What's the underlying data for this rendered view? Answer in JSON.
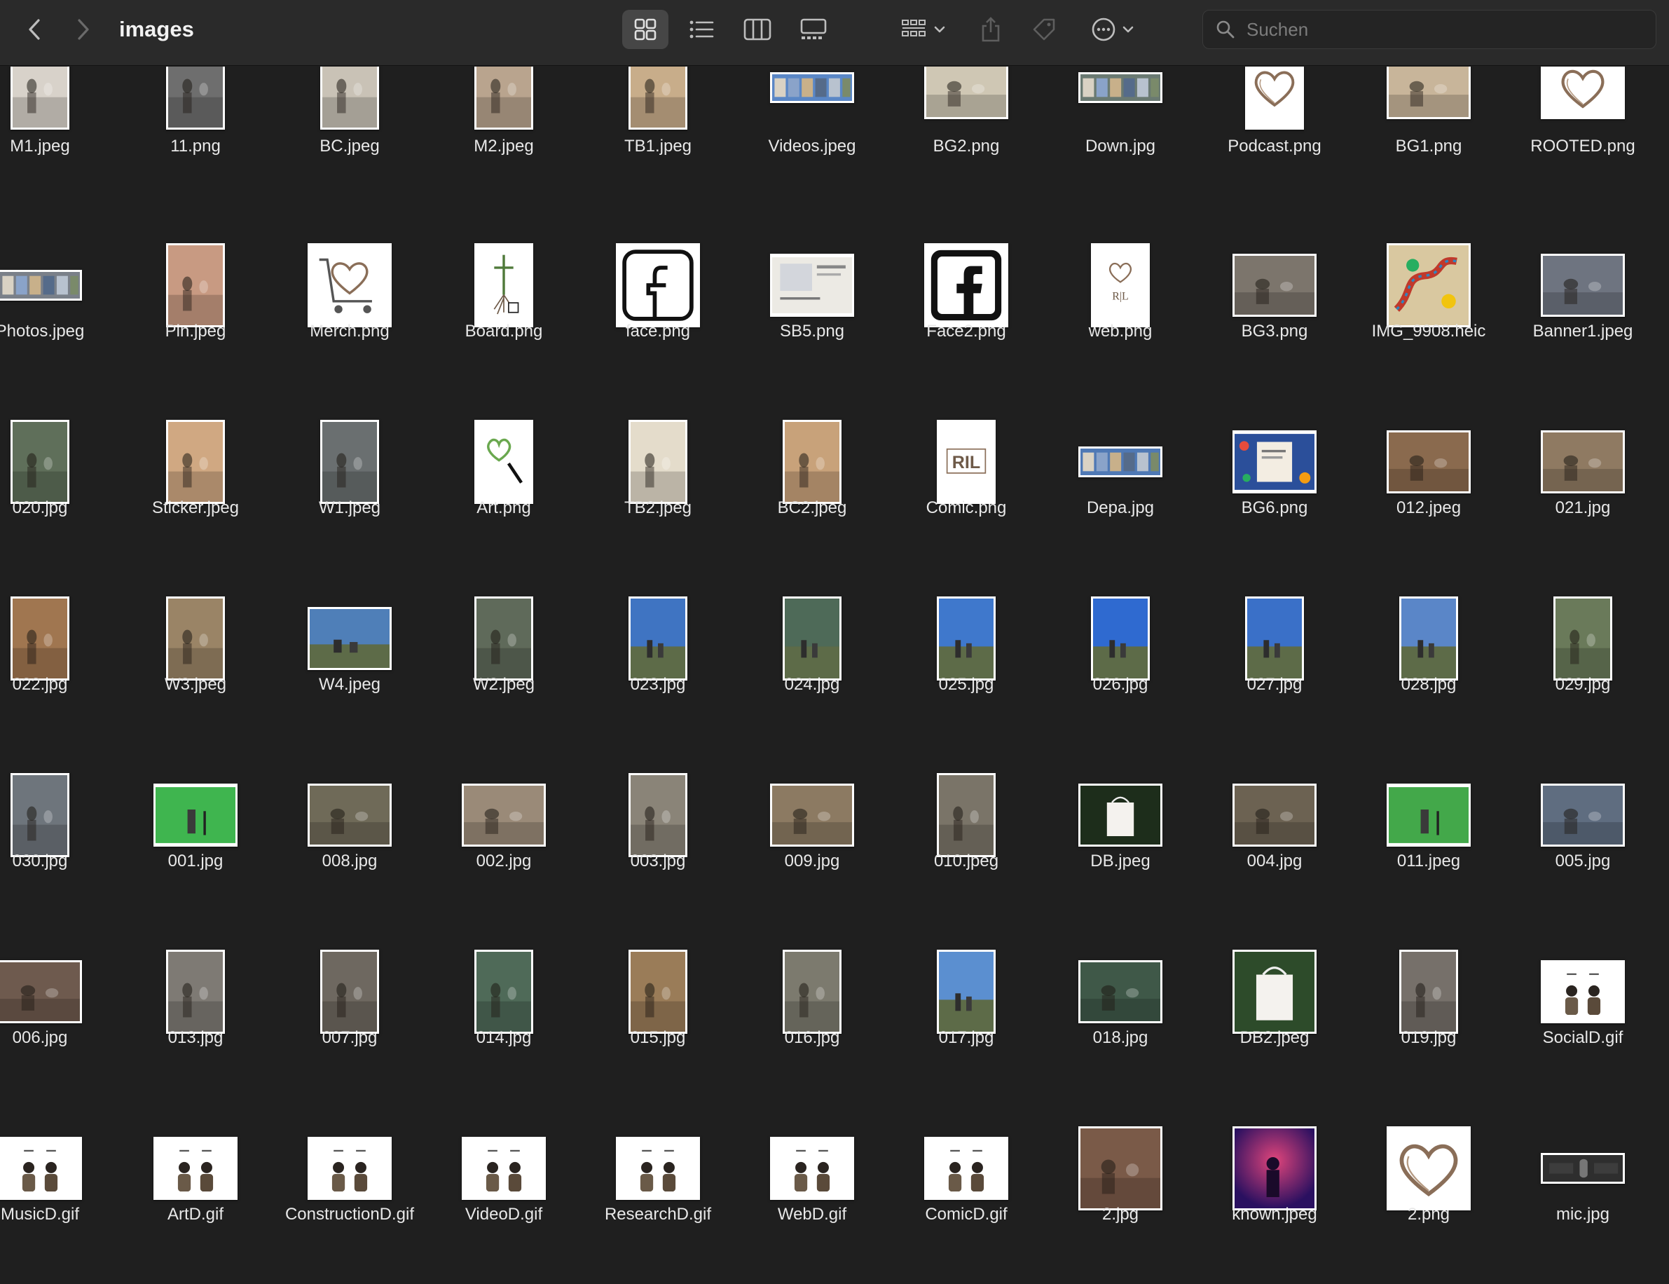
{
  "window": {
    "title": "images"
  },
  "toolbar": {
    "back": "chevron-left-icon",
    "forward": "chevron-right-icon",
    "views": [
      "icon-view-icon",
      "list-view-icon",
      "column-view-icon",
      "gallery-view-icon"
    ],
    "active_view": 0,
    "group": "group-icon",
    "share": "share-icon",
    "tag": "tag-icon",
    "more": "more-icon"
  },
  "search": {
    "placeholder": "Suchen",
    "value": ""
  },
  "files": [
    {
      "name": "M1.jpeg",
      "shape": "p",
      "kind": "photo",
      "color": "#d8d2ca"
    },
    {
      "name": "11.png",
      "shape": "p",
      "kind": "photo",
      "color": "#6e6e6e"
    },
    {
      "name": "BC.jpeg",
      "shape": "p",
      "kind": "photo",
      "color": "#c9c2b6"
    },
    {
      "name": "M2.jpeg",
      "shape": "p",
      "kind": "photo",
      "color": "#b9a48e"
    },
    {
      "name": "TB1.jpeg",
      "shape": "p",
      "kind": "photo",
      "color": "#c8ad8a"
    },
    {
      "name": "Videos.jpeg",
      "shape": "w",
      "kind": "strip",
      "color": "#5a87c6"
    },
    {
      "name": "BG2.png",
      "shape": "l",
      "kind": "photo",
      "color": "#cfc7b4"
    },
    {
      "name": "Down.jpg",
      "shape": "w",
      "kind": "strip",
      "color": "#6a7a72"
    },
    {
      "name": "Podcast.png",
      "shape": "p",
      "kind": "heart",
      "color": "#ffffff"
    },
    {
      "name": "BG1.png",
      "shape": "l",
      "kind": "photo",
      "color": "#c8b59a"
    },
    {
      "name": "ROOTED.png",
      "shape": "l",
      "kind": "heart",
      "color": "#ffffff"
    },
    {
      "name": "Photos.jpeg",
      "shape": "w",
      "kind": "strip",
      "color": "#7a8089"
    },
    {
      "name": "Pin.jpeg",
      "shape": "p",
      "kind": "photo",
      "color": "#c89a82"
    },
    {
      "name": "Merch.png",
      "shape": "s",
      "kind": "cart",
      "color": "#ffffff"
    },
    {
      "name": "Board.png",
      "shape": "p",
      "kind": "tree",
      "color": "#ffffff"
    },
    {
      "name": "face.png",
      "shape": "s",
      "kind": "fb",
      "color": "#ffffff"
    },
    {
      "name": "SB5.png",
      "shape": "l",
      "kind": "doc",
      "color": "#e8e6e0"
    },
    {
      "name": "Face2.png",
      "shape": "s",
      "kind": "fb2",
      "color": "#ffffff"
    },
    {
      "name": "web.png",
      "shape": "p",
      "kind": "ril",
      "color": "#ffffff"
    },
    {
      "name": "BG3.png",
      "shape": "l",
      "kind": "photo",
      "color": "#7c756c"
    },
    {
      "name": "IMG_9908.heic",
      "shape": "s",
      "kind": "board",
      "color": "#d9c8a0"
    },
    {
      "name": "Banner1.jpeg",
      "shape": "l",
      "kind": "photo",
      "color": "#6e7480"
    },
    {
      "name": "020.jpg",
      "shape": "p",
      "kind": "photo",
      "color": "#5f6f5a"
    },
    {
      "name": "Sticker.jpeg",
      "shape": "p",
      "kind": "photo",
      "color": "#d0a882"
    },
    {
      "name": "W1.jpeg",
      "shape": "p",
      "kind": "photo",
      "color": "#6a6f70"
    },
    {
      "name": "Art.png",
      "shape": "p",
      "kind": "art",
      "color": "#ffffff"
    },
    {
      "name": "TB2.jpeg",
      "shape": "p",
      "kind": "photo",
      "color": "#e4dccb"
    },
    {
      "name": "BC2.jpeg",
      "shape": "p",
      "kind": "photo",
      "color": "#c8a27a"
    },
    {
      "name": "Comic.png",
      "shape": "p",
      "kind": "comic",
      "color": "#ffffff"
    },
    {
      "name": "Depa.jpg",
      "shape": "w",
      "kind": "strip",
      "color": "#4f79b5"
    },
    {
      "name": "BG6.png",
      "shape": "l",
      "kind": "colorful",
      "color": "#2b4f9a"
    },
    {
      "name": "012.jpeg",
      "shape": "l",
      "kind": "photo",
      "color": "#8a6a4e"
    },
    {
      "name": "021.jpg",
      "shape": "l",
      "kind": "photo",
      "color": "#8f7a62"
    },
    {
      "name": "022.jpg",
      "shape": "p",
      "kind": "photo",
      "color": "#a07650"
    },
    {
      "name": "W3.jpeg",
      "shape": "p",
      "kind": "photo",
      "color": "#9a8466"
    },
    {
      "name": "W4.jpeg",
      "shape": "l",
      "kind": "sky",
      "color": "#4f7fb8"
    },
    {
      "name": "W2.jpeg",
      "shape": "p",
      "kind": "photo",
      "color": "#5f6a5a"
    },
    {
      "name": "023.jpg",
      "shape": "p",
      "kind": "sky",
      "color": "#3f74c2"
    },
    {
      "name": "024.jpg",
      "shape": "p",
      "kind": "sky",
      "color": "#4e6a58"
    },
    {
      "name": "025.jpg",
      "shape": "p",
      "kind": "sky",
      "color": "#3f78cc"
    },
    {
      "name": "026.jpg",
      "shape": "p",
      "kind": "sky",
      "color": "#2f6ad0"
    },
    {
      "name": "027.jpg",
      "shape": "p",
      "kind": "sky",
      "color": "#3a70c8"
    },
    {
      "name": "028.jpg",
      "shape": "p",
      "kind": "sky",
      "color": "#5a86c8"
    },
    {
      "name": "029.jpg",
      "shape": "p",
      "kind": "photo",
      "color": "#6a7a5a"
    },
    {
      "name": "030.jpg",
      "shape": "p",
      "kind": "photo",
      "color": "#6e757c"
    },
    {
      "name": "001.jpg",
      "shape": "l",
      "kind": "green",
      "color": "#3fb54f"
    },
    {
      "name": "008.jpg",
      "shape": "l",
      "kind": "photo",
      "color": "#6f6a58"
    },
    {
      "name": "002.jpg",
      "shape": "l",
      "kind": "photo",
      "color": "#9a8a78"
    },
    {
      "name": "003.jpg",
      "shape": "p",
      "kind": "photo",
      "color": "#8a8478"
    },
    {
      "name": "009.jpg",
      "shape": "l",
      "kind": "photo",
      "color": "#8c7a62"
    },
    {
      "name": "010.jpeg",
      "shape": "p",
      "kind": "photo",
      "color": "#7a7468"
    },
    {
      "name": "DB.jpeg",
      "shape": "l",
      "kind": "bag",
      "color": "#1d2d1b"
    },
    {
      "name": "004.jpg",
      "shape": "l",
      "kind": "photo",
      "color": "#6c6252"
    },
    {
      "name": "011.jpeg",
      "shape": "l",
      "kind": "green",
      "color": "#43a84a"
    },
    {
      "name": "005.jpg",
      "shape": "l",
      "kind": "photo",
      "color": "#5f6d80"
    },
    {
      "name": "006.jpg",
      "shape": "l",
      "kind": "photo",
      "color": "#6e5a4e"
    },
    {
      "name": "013.jpg",
      "shape": "p",
      "kind": "photo",
      "color": "#7e7a74"
    },
    {
      "name": "007.jpg",
      "shape": "p",
      "kind": "photo",
      "color": "#6e6860"
    },
    {
      "name": "014.jpg",
      "shape": "p",
      "kind": "photo",
      "color": "#4f6a58"
    },
    {
      "name": "015.jpg",
      "shape": "p",
      "kind": "photo",
      "color": "#9a7c58"
    },
    {
      "name": "016.jpg",
      "shape": "p",
      "kind": "photo",
      "color": "#7c7a6e"
    },
    {
      "name": "017.jpg",
      "shape": "p",
      "kind": "sky",
      "color": "#5b8fd0"
    },
    {
      "name": "018.jpg",
      "shape": "l",
      "kind": "photo",
      "color": "#3f5848"
    },
    {
      "name": "DB2.jpeg",
      "shape": "s",
      "kind": "bag",
      "color": "#2d4b2a"
    },
    {
      "name": "019.jpg",
      "shape": "p",
      "kind": "photo",
      "color": "#76706a"
    },
    {
      "name": "SocialD.gif",
      "shape": "l",
      "kind": "people",
      "color": "#ffffff"
    },
    {
      "name": "MusicD.gif",
      "shape": "l",
      "kind": "people",
      "color": "#ffffff"
    },
    {
      "name": "ArtD.gif",
      "shape": "l",
      "kind": "people",
      "color": "#ffffff"
    },
    {
      "name": "ConstructionD.gif",
      "shape": "l",
      "kind": "people",
      "color": "#ffffff"
    },
    {
      "name": "VideoD.gif",
      "shape": "l",
      "kind": "people",
      "color": "#ffffff"
    },
    {
      "name": "ResearchD.gif",
      "shape": "l",
      "kind": "people",
      "color": "#ffffff"
    },
    {
      "name": "WebD.gif",
      "shape": "l",
      "kind": "people",
      "color": "#ffffff"
    },
    {
      "name": "ComicD.gif",
      "shape": "l",
      "kind": "people",
      "color": "#ffffff"
    },
    {
      "name": "2.jpg",
      "shape": "s",
      "kind": "photo",
      "color": "#7a5a48"
    },
    {
      "name": "known.jpeg",
      "shape": "s",
      "kind": "concert",
      "color": "#5a1f8a"
    },
    {
      "name": "2.png",
      "shape": "s",
      "kind": "heart",
      "color": "#ffffff"
    },
    {
      "name": "mic.jpg",
      "shape": "w",
      "kind": "mic",
      "color": "#3a3a3a"
    }
  ]
}
